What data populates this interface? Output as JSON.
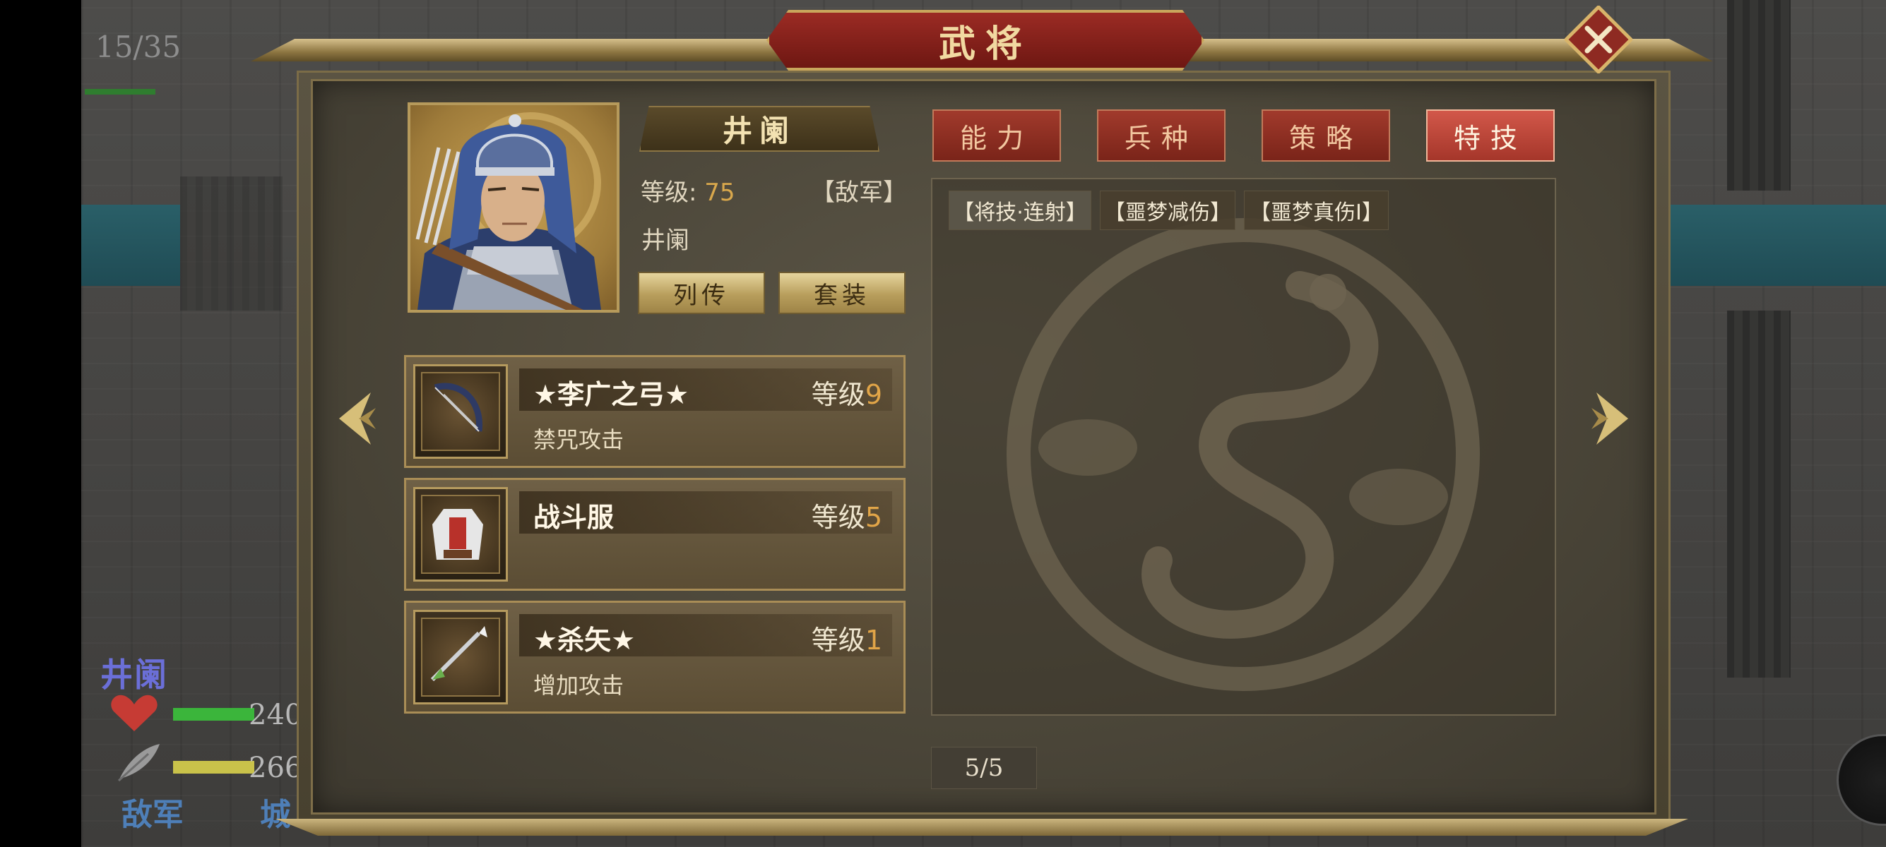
{
  "hud": {
    "counter": "15/35",
    "unit_name": "井阑",
    "hp": "240",
    "mp": "266",
    "side": "敌军",
    "city": "城"
  },
  "title": "武将",
  "general": {
    "name_plate": "井阑",
    "level_label": "等级:",
    "level_value": "75",
    "faction": "【敌军】",
    "name": "井阑",
    "biography_button": "列传",
    "set_button": "套装"
  },
  "equipment": [
    {
      "name": "★李广之弓★",
      "level_label": "等级",
      "level": "9",
      "desc": "禁咒攻击",
      "icon": "bow-icon"
    },
    {
      "name": "战斗服",
      "level_label": "等级",
      "level": "5",
      "desc": "",
      "icon": "armor-icon"
    },
    {
      "name": "★杀矢★",
      "level_label": "等级",
      "level": "1",
      "desc": "增加攻击",
      "icon": "arrow-icon"
    }
  ],
  "tabs": [
    {
      "label": "能力",
      "active": false
    },
    {
      "label": "兵种",
      "active": false
    },
    {
      "label": "策略",
      "active": false
    },
    {
      "label": "特技",
      "active": true
    }
  ],
  "skills": [
    "【将技·连射】",
    "【噩梦减伤】",
    "【噩梦真伤Ⅰ】"
  ],
  "pager": "5/5",
  "colors": {
    "accent_red": "#a13a2c",
    "gold": "#b89e5c",
    "level_orange": "#e1a548"
  }
}
